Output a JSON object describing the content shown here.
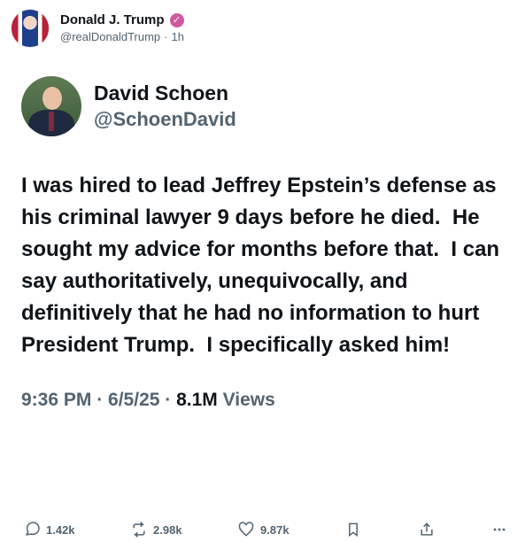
{
  "top_post": {
    "display_name": "Donald J. Trump",
    "handle": "@realDonaldTrump",
    "time": "1h",
    "badge_icon": "verified-badge-icon",
    "badge_color": "#d05aa1"
  },
  "embedded": {
    "display_name": "David Schoen",
    "handle": "@SchoenDavid",
    "text": "I was hired to lead Jeffrey Epstein’s defense as his criminal lawyer 9 days before he died.  He sought my advice for months before that.  I can say authoritatively, unequivocally, and definitively that he had no information to hurt President Trump.  I specifically asked him!",
    "time": "9:36 PM",
    "date": "6/5/25",
    "views_count": "8.1M",
    "views_label": "Views"
  },
  "actions": {
    "replies": "1.42k",
    "reposts": "2.98k",
    "likes": "9.87k",
    "bookmark_icon": "bookmark-icon",
    "share_icon": "share-icon",
    "more_icon": "more-icon"
  }
}
